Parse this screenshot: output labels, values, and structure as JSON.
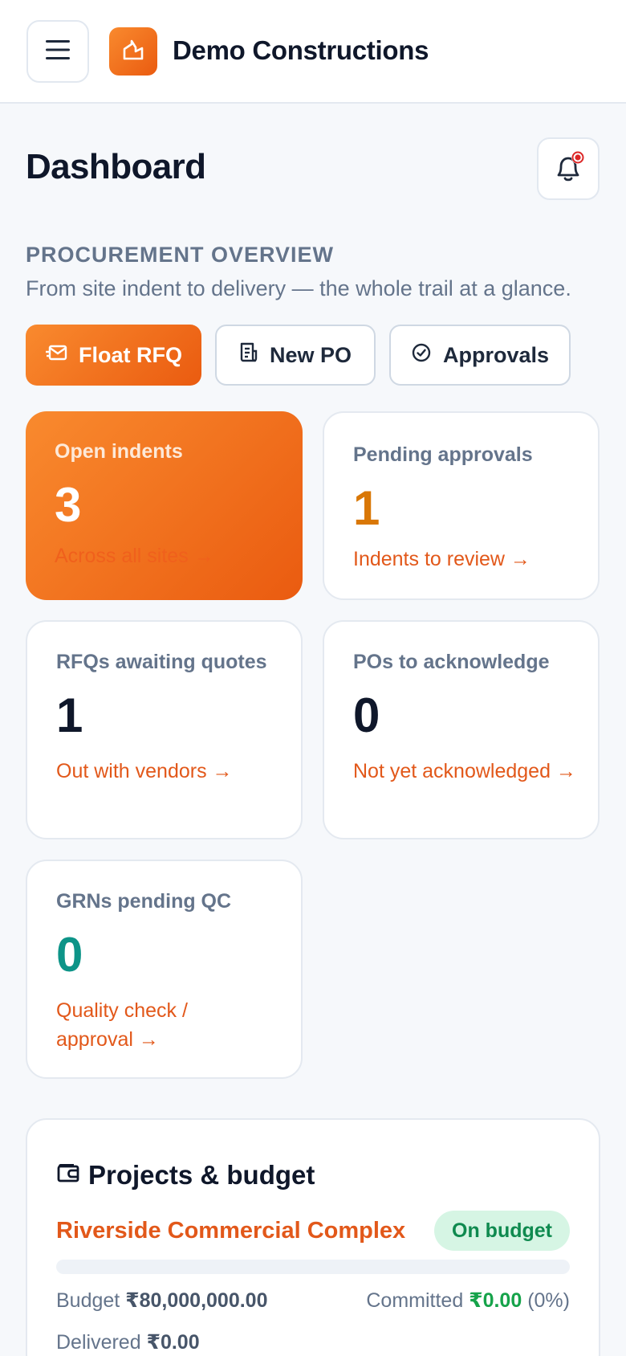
{
  "header": {
    "menu_icon": "hamburger-icon",
    "logo_icon": "building-icon",
    "company_name": "Demo Constructions"
  },
  "page": {
    "title": "Dashboard",
    "notification_icon": "bell-icon",
    "notification_dot_color": "#dc2626"
  },
  "overview": {
    "label": "PROCUREMENT OVERVIEW",
    "subtitle": "From site indent to delivery — the whole trail at a glance."
  },
  "actions": [
    {
      "label": "Float RFQ",
      "icon": "send-mail-icon"
    },
    {
      "label": "New PO",
      "icon": "document-icon"
    },
    {
      "label": "Approvals",
      "icon": "check-circle-icon"
    }
  ],
  "stats": [
    {
      "label": "Open indents",
      "value": "3",
      "link": "Across all sites →",
      "value_color": "#ffffff"
    },
    {
      "label": "Pending approvals",
      "value": "1",
      "link": "Indents to review →",
      "value_color": "#d97706"
    },
    {
      "label": "RFQs awaiting quotes",
      "value": "1",
      "link": "Out with vendors →",
      "value_color": "#0f172a"
    },
    {
      "label": "POs to acknowledge",
      "value": "0",
      "link": "Not yet acknowledged →",
      "value_color": "#0f172a"
    },
    {
      "label": "GRNs pending QC",
      "value": "0",
      "link": "Quality check / approval →",
      "value_color": "#0d9488"
    }
  ],
  "budget": {
    "title": "Projects & budget",
    "icon": "wallet-icon",
    "project": {
      "name": "Riverside Commercial Complex",
      "status": "On budget",
      "progress_fraction": 0,
      "budget_label": "Budget",
      "budget_value": "₹80,000,000.00",
      "committed_label": "Committed",
      "committed_value": "₹0.00",
      "committed_percent": "(0%)",
      "delivered_label": "Delivered",
      "delivered_value": "₹0.00"
    }
  }
}
